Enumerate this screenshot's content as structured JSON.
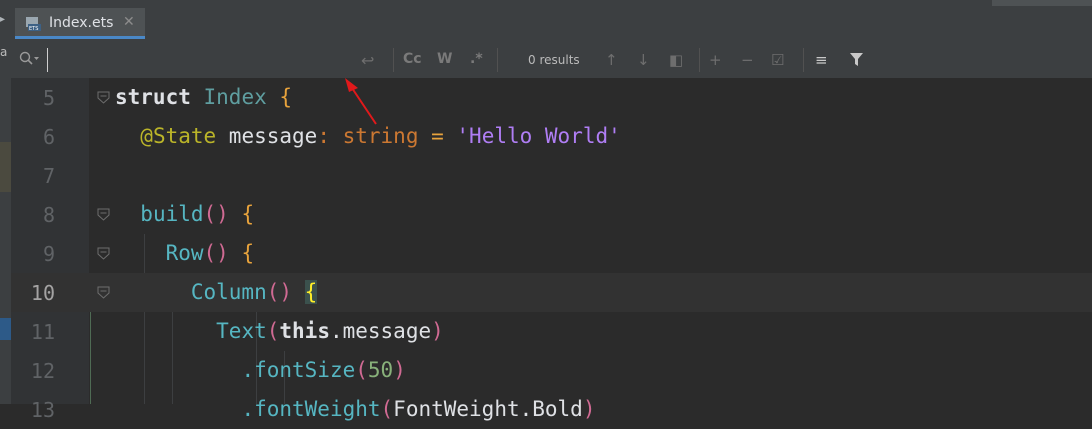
{
  "tab": {
    "label": "Index.ets",
    "icon": "ets-file-icon"
  },
  "find": {
    "placeholder": "",
    "results": "0 results",
    "options": [
      "Cc",
      "W",
      ".*"
    ]
  },
  "editor": {
    "lines": [
      {
        "num": "5",
        "tokens": [
          {
            "t": "struct",
            "c": "kw2"
          },
          {
            "t": " ",
            "c": ""
          },
          {
            "t": "Index",
            "c": "type"
          },
          {
            "t": " ",
            "c": ""
          },
          {
            "t": "{",
            "c": "brace"
          }
        ]
      },
      {
        "num": "6",
        "tokens": [
          {
            "t": "  ",
            "c": ""
          },
          {
            "t": "@State",
            "c": "deco"
          },
          {
            "t": " message",
            "c": "ident"
          },
          {
            "t": ": ",
            "c": "tk"
          },
          {
            "t": "string",
            "c": "tk"
          },
          {
            "t": " = ",
            "c": "brace"
          },
          {
            "t": "'Hello World'",
            "c": "str"
          }
        ]
      },
      {
        "num": "7",
        "tokens": []
      },
      {
        "num": "8",
        "tokens": [
          {
            "t": "  ",
            "c": ""
          },
          {
            "t": "build",
            "c": "fn"
          },
          {
            "t": "()",
            "c": "paren"
          },
          {
            "t": " ",
            "c": ""
          },
          {
            "t": "{",
            "c": "brace"
          }
        ]
      },
      {
        "num": "9",
        "tokens": [
          {
            "t": "    ",
            "c": ""
          },
          {
            "t": "Row",
            "c": "fn"
          },
          {
            "t": "()",
            "c": "paren"
          },
          {
            "t": " ",
            "c": ""
          },
          {
            "t": "{",
            "c": "brace"
          }
        ]
      },
      {
        "num": "10",
        "tokens": [
          {
            "t": "      ",
            "c": ""
          },
          {
            "t": "Column",
            "c": "fn"
          },
          {
            "t": "()",
            "c": "paren"
          },
          {
            "t": " ",
            "c": ""
          },
          {
            "t": "{",
            "c": "brace-hl"
          }
        ]
      },
      {
        "num": "11",
        "tokens": [
          {
            "t": "        ",
            "c": ""
          },
          {
            "t": "Text",
            "c": "fn"
          },
          {
            "t": "(",
            "c": "paren"
          },
          {
            "t": "this",
            "c": "kw2"
          },
          {
            "t": ".message",
            "c": "ident"
          },
          {
            "t": ")",
            "c": "paren"
          }
        ]
      },
      {
        "num": "12",
        "tokens": [
          {
            "t": "          ",
            "c": ""
          },
          {
            "t": ".fontSize",
            "c": "fn"
          },
          {
            "t": "(",
            "c": "paren"
          },
          {
            "t": "50",
            "c": "num"
          },
          {
            "t": ")",
            "c": "paren"
          }
        ]
      },
      {
        "num": "13",
        "tokens": [
          {
            "t": "          ",
            "c": ""
          },
          {
            "t": ".fontWeight",
            "c": "fn"
          },
          {
            "t": "(",
            "c": "paren"
          },
          {
            "t": "FontWeight.Bold",
            "c": "ident"
          },
          {
            "t": ")",
            "c": "paren"
          }
        ]
      }
    ],
    "current_line": "10"
  },
  "colors": {
    "accent": "#4a88c7",
    "arrow": "#e0191b"
  }
}
